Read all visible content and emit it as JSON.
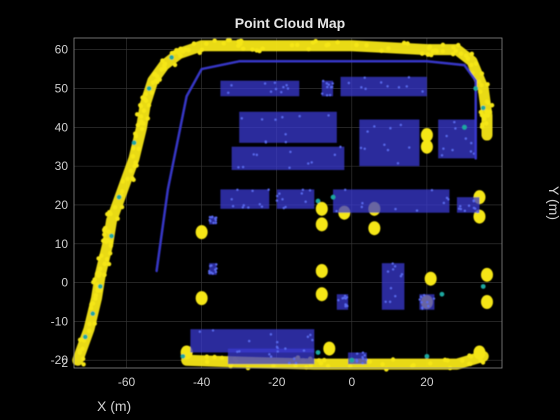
{
  "chart_data": {
    "type": "scatter",
    "title": "Point Cloud Map",
    "xlabel": "X (m)",
    "ylabel": "Y (m)",
    "zlabel_tick": "2",
    "xlim": [
      -74,
      40
    ],
    "ylim": [
      -22,
      63
    ],
    "xticks": [
      -60,
      -40,
      -20,
      0,
      20
    ],
    "yticks": [
      -20,
      -10,
      0,
      10,
      20,
      30,
      40,
      50,
      60
    ],
    "grid": true,
    "colormap": {
      "low": "#2a2ab4",
      "mid": "#1fa8a0",
      "high": "#f5e614"
    },
    "background": "#000000",
    "series": [
      {
        "values_description": "yellow (high) point-cloud band outlining the map boundary",
        "color": "#f5e614",
        "polylines": [
          [
            [
              -73,
              -20
            ],
            [
              -70,
              -12
            ],
            [
              -68,
              -4
            ],
            [
              -67,
              2
            ],
            [
              -66,
              6
            ],
            [
              -65,
              10
            ],
            [
              -64,
              16
            ],
            [
              -61,
              24
            ],
            [
              -58,
              32
            ],
            [
              -56,
              40
            ],
            [
              -55,
              46
            ],
            [
              -53,
              52
            ],
            [
              -50,
              56
            ],
            [
              -46,
              59
            ],
            [
              -40,
              61
            ],
            [
              -30,
              61
            ],
            [
              -20,
              61
            ],
            [
              0,
              61
            ],
            [
              20,
              60
            ],
            [
              28,
              60
            ],
            [
              32,
              57
            ],
            [
              35,
              50
            ],
            [
              36,
              43
            ],
            [
              36,
              38
            ]
          ],
          [
            [
              -44,
              -20
            ],
            [
              -30,
              -20.5
            ],
            [
              -10,
              -21
            ],
            [
              10,
              -21
            ],
            [
              28,
              -21
            ],
            [
              35,
              -19
            ]
          ]
        ],
        "blobs": [
          [
            -40,
            13
          ],
          [
            -40,
            -4
          ],
          [
            -8,
            19
          ],
          [
            -8,
            15
          ],
          [
            -8,
            3
          ],
          [
            -8,
            -3
          ],
          [
            -2,
            18
          ],
          [
            6,
            19
          ],
          [
            6,
            14
          ],
          [
            20,
            38
          ],
          [
            20,
            35
          ],
          [
            21,
            1
          ],
          [
            20,
            -5
          ],
          [
            34,
            22
          ],
          [
            34,
            17
          ],
          [
            36,
            2
          ],
          [
            36,
            -5
          ],
          [
            34,
            -18
          ],
          [
            -6,
            -17
          ],
          [
            -44,
            -18
          ]
        ]
      },
      {
        "values_description": "blue (low) structures: parking rows and trajectory",
        "color": "#3a3ad0",
        "polylines": [
          [
            [
              -52,
              3
            ],
            [
              -49,
              24
            ],
            [
              -44,
              48
            ],
            [
              -40,
              55
            ],
            [
              -30,
              57
            ],
            [
              0,
              57
            ],
            [
              20,
              57
            ],
            [
              30,
              56
            ],
            [
              33,
              52
            ],
            [
              33,
              42
            ],
            [
              33,
              32
            ]
          ]
        ],
        "rects": [
          [
            -35,
            48,
            -14,
            52
          ],
          [
            -8,
            48,
            -5,
            52
          ],
          [
            -3,
            48,
            20,
            53
          ],
          [
            -30,
            36,
            -4,
            44
          ],
          [
            -32,
            29,
            -2,
            35
          ],
          [
            2,
            30,
            18,
            42
          ],
          [
            23,
            32,
            33,
            42
          ],
          [
            -35,
            19,
            -22,
            24
          ],
          [
            -20,
            19,
            -10,
            24
          ],
          [
            -5,
            18,
            26,
            24
          ],
          [
            28,
            18,
            34,
            22
          ],
          [
            -38,
            15,
            -36,
            17
          ],
          [
            -38,
            2,
            -36,
            5
          ],
          [
            -4,
            -7,
            -1,
            -3
          ],
          [
            8,
            -7,
            14,
            5
          ],
          [
            18,
            -7,
            22,
            -3
          ],
          [
            -43,
            -18,
            -10,
            -12
          ],
          [
            -33,
            -21,
            -10,
            -17
          ],
          [
            -1,
            -21,
            4,
            -18
          ]
        ]
      },
      {
        "values_description": "teal (mid) points scattered along the boundary edges",
        "color": "#1fa8a0",
        "points": [
          [
            -71,
            -14
          ],
          [
            -69,
            -8
          ],
          [
            -67,
            -1
          ],
          [
            -64,
            12
          ],
          [
            -62,
            22
          ],
          [
            -58,
            36
          ],
          [
            -54,
            50
          ],
          [
            -48,
            58
          ],
          [
            33,
            50
          ],
          [
            35,
            45
          ],
          [
            30,
            40
          ],
          [
            -9,
            21
          ],
          [
            -5,
            22
          ],
          [
            24,
            -3
          ],
          [
            35,
            -1
          ],
          [
            -45,
            -19
          ],
          [
            -9,
            -18
          ],
          [
            0,
            -20
          ],
          [
            20,
            -19
          ]
        ]
      }
    ]
  }
}
